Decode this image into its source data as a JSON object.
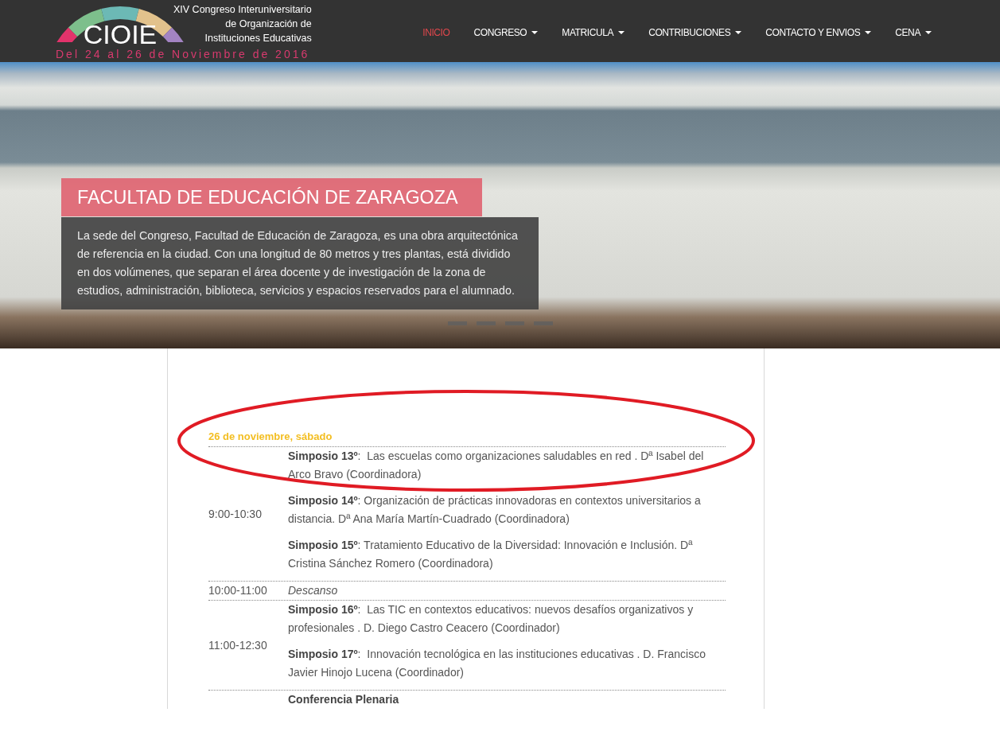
{
  "header": {
    "logo": {
      "wordmark": "CIOIE",
      "tagline": "XIV Congreso Interuniversitario\nde Organización de\nInstituciones Educativas",
      "dates": "Del 24 al 26 de Noviembre de 2016"
    },
    "nav": [
      {
        "label": "INICIO",
        "selected": true,
        "dropdown": false
      },
      {
        "label": "CONGRESO",
        "selected": false,
        "dropdown": true
      },
      {
        "label": "MATRICULA",
        "selected": false,
        "dropdown": true
      },
      {
        "label": "CONTRIBUCIONES",
        "selected": false,
        "dropdown": true
      },
      {
        "label": "CONTACTO Y ENVIOS",
        "selected": false,
        "dropdown": true
      },
      {
        "label": "CENA",
        "selected": false,
        "dropdown": true
      }
    ]
  },
  "hero": {
    "caption": {
      "title": "FACULTAD DE EDUCACIÓN DE ZARAGOZA",
      "text": "La sede del Congreso, Facultad de Educación de Zaragoza, es una obra arquitectónica de referencia en la ciudad. Con una longitud de 80 metros y tres plantas, está dividido en dos volúmenes, que separan el área docente y de investigación de la zona de estudios, administración, biblioteca, servicios y espacios reservados para el alumnado."
    },
    "indicators": [
      {
        "selected": false
      },
      {
        "selected": false
      },
      {
        "selected": false
      },
      {
        "selected": false
      }
    ]
  },
  "schedule": {
    "day": "26 de noviembre, sábado",
    "rows": [
      {
        "time": "9:00-10:30",
        "entries": [
          {
            "kind": "session",
            "text": "**Simposio 13º**:  Las escuelas como organizaciones saludables en red . Dª Isabel del Arco Bravo (Coordinadora)"
          },
          {
            "kind": "session",
            "text": "**Simposio 14º**: Organización de prácticas innovadoras en contextos universitarios a distancia. Dª Ana María Martín-Cuadrado (Coordinadora)"
          },
          {
            "kind": "session",
            "text": "**Simposio 15º**: Tratamiento Educativo de la Diversidad: Innovación e Inclusión. Dª Cristina Sánchez Romero (Coordinadora)"
          }
        ]
      },
      {
        "time": "10:00-11:00",
        "entries": [
          {
            "kind": "break",
            "text": "Descanso"
          }
        ]
      },
      {
        "time": "11:00-12:30",
        "entries": [
          {
            "kind": "session",
            "text": "**Simposio 16º**:  Las TIC en contextos educativos: nuevos desafíos organizativos y profesionales . D. Diego Castro Ceacero (Coordinador)"
          },
          {
            "kind": "session",
            "text": "**Simposio 17º**:  Innovación tecnológica en las instituciones educativas . D. Francisco Javier Hinojo Lucena (Coordinador)"
          }
        ]
      },
      {
        "entries": [
          {
            "kind": "plenary",
            "text": "Conferencia Plenaria"
          }
        ]
      }
    ]
  },
  "annotations": [
    {
      "kind": "ellipse"
    }
  ]
}
